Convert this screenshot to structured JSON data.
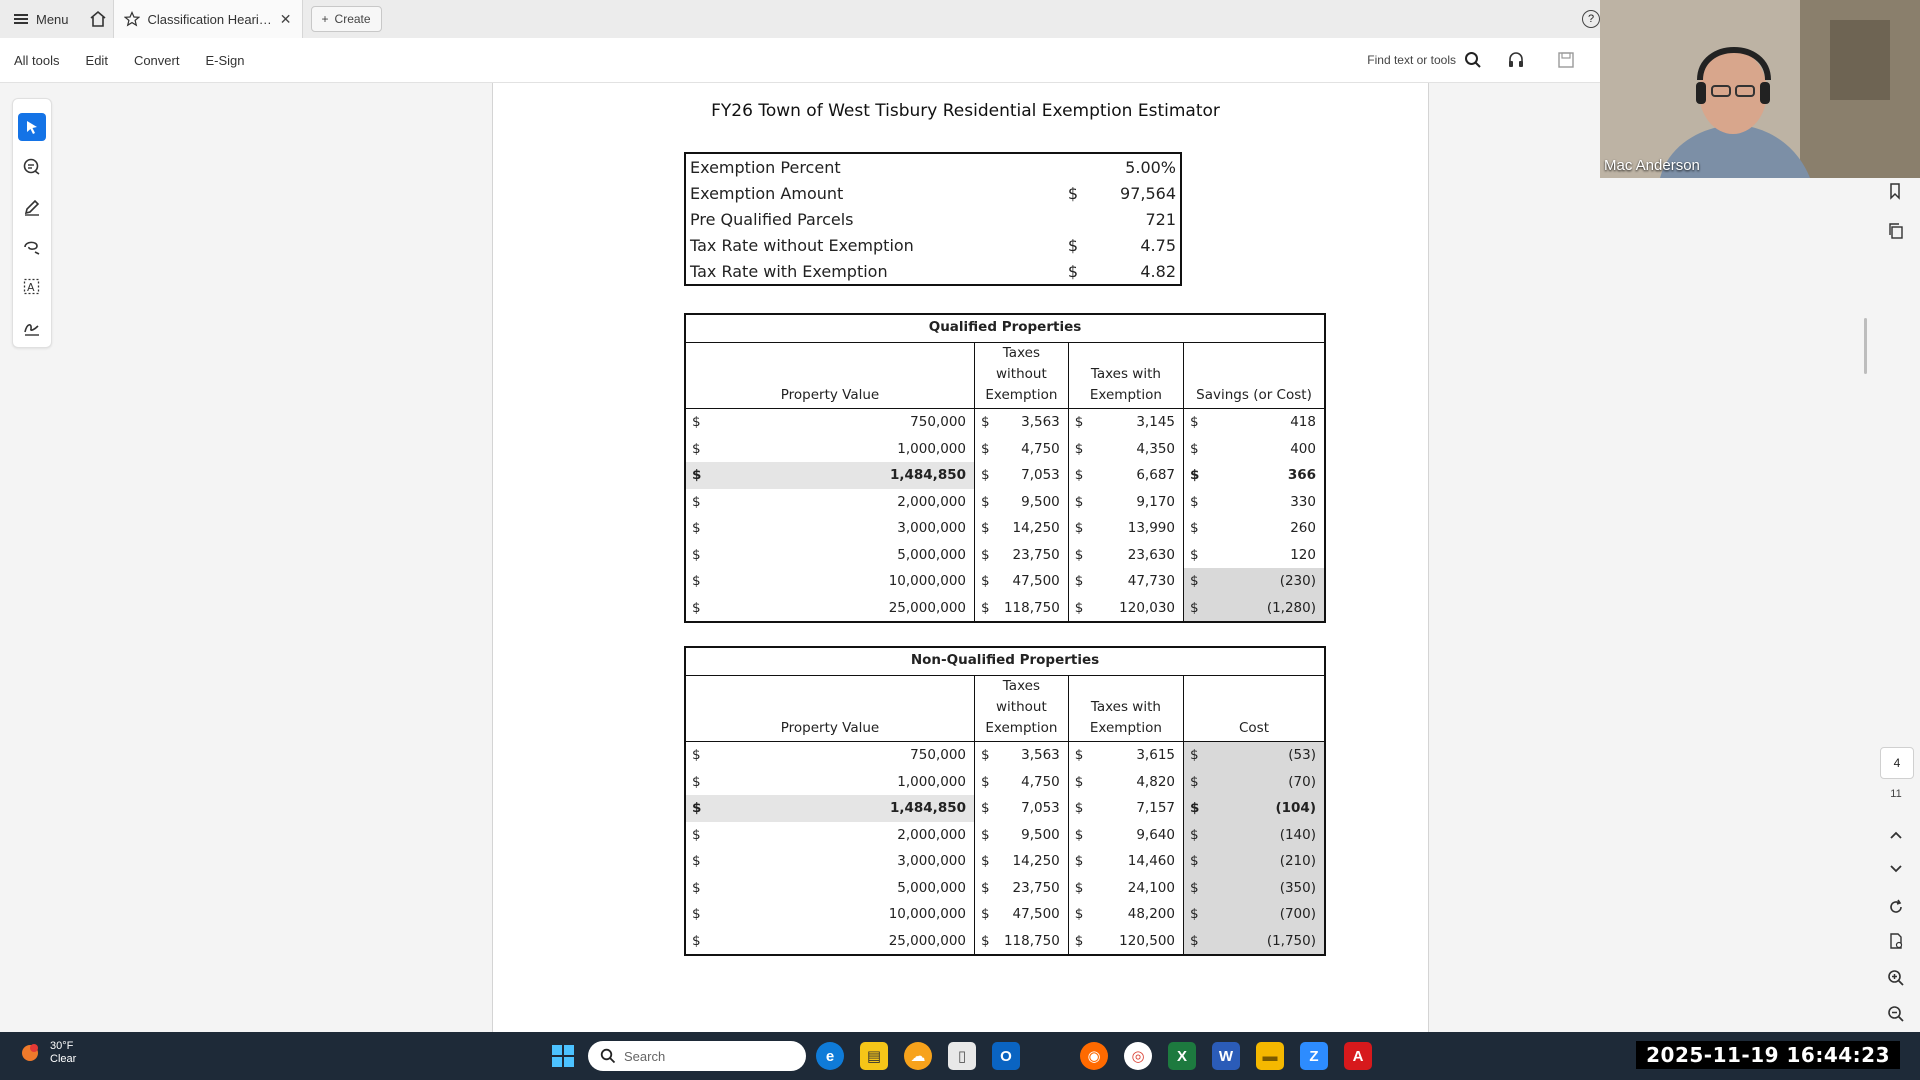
{
  "tabbar": {
    "menu_label": "Menu",
    "doc_tab_title": "Classification Hearing As",
    "create_label": "Create"
  },
  "toolbar": {
    "items": [
      "All tools",
      "Edit",
      "Convert",
      "E-Sign"
    ],
    "find_placeholder": "Find text or tools"
  },
  "document": {
    "title": "FY26 Town of West Tisbury Residential Exemption Estimator",
    "summary": [
      {
        "label": "Exemption Percent",
        "currency": "",
        "value": "5.00%"
      },
      {
        "label": "Exemption Amount",
        "currency": "$",
        "value": "97,564"
      },
      {
        "label": "Pre Qualified Parcels",
        "currency": "",
        "value": "721"
      },
      {
        "label": "Tax Rate without Exemption",
        "currency": "$",
        "value": "4.75"
      },
      {
        "label": "Tax Rate with Exemption",
        "currency": "$",
        "value": "4.82"
      }
    ],
    "qualified": {
      "title": "Qualified Properties",
      "headers": [
        "Property Value",
        "Taxes without Exemption",
        "Taxes with Exemption",
        "Savings (or Cost)"
      ],
      "rows": [
        {
          "pv": "750,000",
          "tw": "3,563",
          "tx": "3,145",
          "s": "418"
        },
        {
          "pv": "1,000,000",
          "tw": "4,750",
          "tx": "4,350",
          "s": "400"
        },
        {
          "pv": "1,484,850",
          "tw": "7,053",
          "tx": "6,687",
          "s": "366"
        },
        {
          "pv": "2,000,000",
          "tw": "9,500",
          "tx": "9,170",
          "s": "330"
        },
        {
          "pv": "3,000,000",
          "tw": "14,250",
          "tx": "13,990",
          "s": "260"
        },
        {
          "pv": "5,000,000",
          "tw": "23,750",
          "tx": "23,630",
          "s": "120"
        },
        {
          "pv": "10,000,000",
          "tw": "47,500",
          "tx": "47,730",
          "s": "(230)"
        },
        {
          "pv": "25,000,000",
          "tw": "118,750",
          "tx": "120,030",
          "s": "(1,280)"
        }
      ]
    },
    "non_qualified": {
      "title": "Non-Qualified Properties",
      "headers": [
        "Property Value",
        "Taxes without Exemption",
        "Taxes with Exemption",
        "Cost"
      ],
      "rows": [
        {
          "pv": "750,000",
          "tw": "3,563",
          "tx": "3,615",
          "s": "(53)"
        },
        {
          "pv": "1,000,000",
          "tw": "4,750",
          "tx": "4,820",
          "s": "(70)"
        },
        {
          "pv": "1,484,850",
          "tw": "7,053",
          "tx": "7,157",
          "s": "(104)"
        },
        {
          "pv": "2,000,000",
          "tw": "9,500",
          "tx": "9,640",
          "s": "(140)"
        },
        {
          "pv": "3,000,000",
          "tw": "14,250",
          "tx": "14,460",
          "s": "(210)"
        },
        {
          "pv": "5,000,000",
          "tw": "23,750",
          "tx": "24,100",
          "s": "(350)"
        },
        {
          "pv": "10,000,000",
          "tw": "47,500",
          "tx": "48,200",
          "s": "(700)"
        },
        {
          "pv": "25,000,000",
          "tw": "118,750",
          "tx": "120,500",
          "s": "(1,750)"
        }
      ]
    },
    "currency_symbol": "$"
  },
  "sidebar_right": {
    "page_current": "4",
    "page_total": "11"
  },
  "webcam": {
    "participant_name": "Mac Anderson"
  },
  "taskbar": {
    "weather_temp": "30°F",
    "weather_cond": "Clear",
    "search_placeholder": "Search",
    "clock": "2025-11-19 16:44:23"
  },
  "colors": {
    "accent": "#1473e6",
    "taskbar_bg": "#1e2a38",
    "negative_cell_bg": "#d9d9d9",
    "highlight_row_bg": "#e5e5e5"
  }
}
